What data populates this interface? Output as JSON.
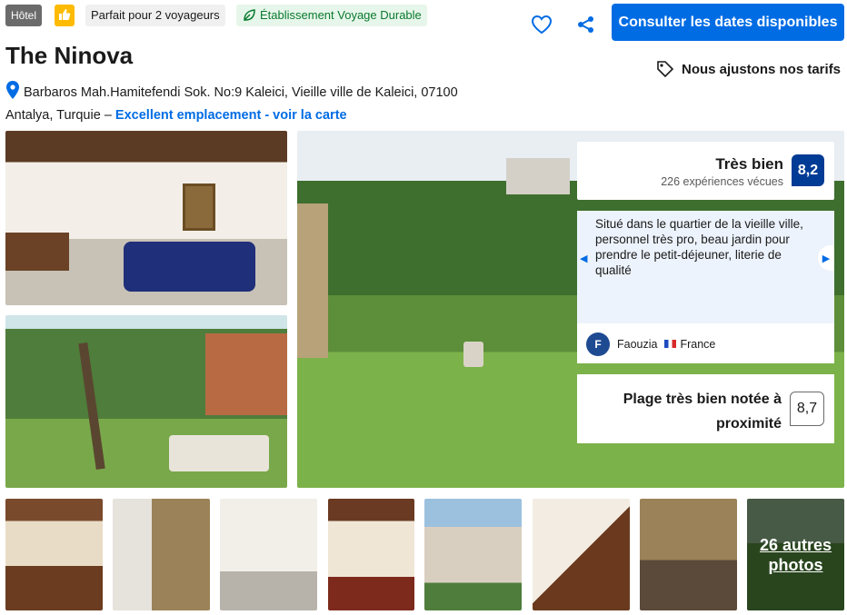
{
  "badges": {
    "type": "Hôtel",
    "travellers": "Parfait pour 2 voyageurs",
    "sustainable": "Établissement Voyage Durable"
  },
  "header": {
    "cta_label": "Consulter les dates disponibles",
    "price_match": "Nous ajustons nos tarifs"
  },
  "hotel": {
    "name": "The Ninova",
    "address_line1": "Barbaros Mah.Hamitefendi Sok. No:9 Kaleici, Vieille ville de Kaleici, 07100",
    "address_line2": "Antalya, Turquie –",
    "location_link": "Excellent emplacement - voir la carte"
  },
  "rating": {
    "label": "Très bien",
    "count": "226 expériences vécues",
    "score": "8,2"
  },
  "review": {
    "text": "Situé dans le quartier de la vieille ville, personnel très pro, beau jardin pour prendre le petit-déjeuner, literie de qualité",
    "avatar_initial": "F",
    "author": "Faouzia",
    "country": "France"
  },
  "beach": {
    "label": "Plage très bien notée à proximité",
    "score": "8,7"
  },
  "gallery": {
    "more_photos": "26 autres photos"
  },
  "colors": {
    "accent": "#006ce4",
    "score_bg": "#003b95",
    "eco_green": "#0a7a2f",
    "genius_yellow": "#febb02"
  }
}
